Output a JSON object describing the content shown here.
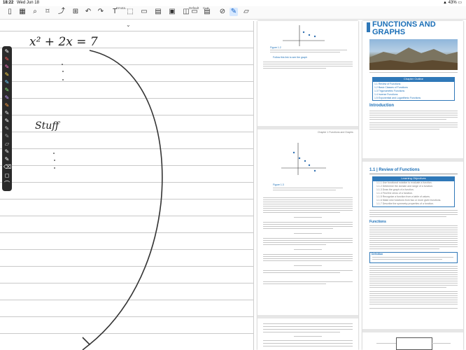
{
  "status": {
    "time": "18:22",
    "date": "Wed Jun 18",
    "battery": "43%"
  },
  "toolbar": {
    "center_title": "Emota...",
    "default_label": "Default",
    "curr_label": "Curr",
    "icons": [
      "sidebar-icon",
      "thumbnails-icon",
      "search-icon",
      "bookmark-icon",
      "share-icon",
      "add-page-icon",
      "undo-icon",
      "redo-icon",
      "text-select-icon",
      "crop-icon",
      "page-icon",
      "layout-icon",
      "lasso-icon",
      "pen-icon",
      "highlighter-icon",
      "eraser-icon",
      "more-icon"
    ]
  },
  "notebook": {
    "equation": "x² + 2x = 7",
    "word": "Stuff"
  },
  "palette": {
    "colors": [
      "#ff5a5a",
      "#ff79c9",
      "#ffd84a",
      "#6fd3ff",
      "#8ef27d",
      "#ffffff",
      "#c9a0ff",
      "#ff9f43",
      "#e0e0e0",
      "#ffffff",
      "#c0c0c0",
      "#9b9b9b",
      "#dcdcdc",
      "#eaeaea",
      "#ffffff",
      "#f2f2f2",
      "#ffffff",
      "#ffffff"
    ]
  },
  "doc_middle": {
    "link_text": "Follow this link to see the graph",
    "figure_caption_1": "Figure 1.2",
    "figure_caption_2": "Figure 1.3",
    "chapter_header": "Chapter 1 Functions and Graphs"
  },
  "doc_right": {
    "title_line1": "FUNCTIONS AND",
    "title_line2": "GRAPHS",
    "chapter_outline": "Chapter Outline",
    "outline_items": [
      "1.1 Review of Functions",
      "1.2 Basic Classes of Functions",
      "1.3 Trigonometric Functions",
      "1.4 Inverse Functions",
      "1.5 Exponential and Logarithmic Functions"
    ],
    "intro_heading": "Introduction",
    "section_heading": "1.1 | Review of Functions",
    "learning_objectives": "Learning Objectives",
    "objectives": [
      "1.1.1 Use functional notation to evaluate a function.",
      "1.1.2 Determine the domain and range of a function.",
      "1.1.3 Draw the graph of a function.",
      "1.1.4 Find the zeros of a function.",
      "1.1.5 Recognize a function from a table of values.",
      "1.1.6 Make new functions from two or more given functions.",
      "1.1.7 Describe the symmetry properties of a function."
    ],
    "functions_heading": "Functions",
    "definition_label": "Definition"
  }
}
